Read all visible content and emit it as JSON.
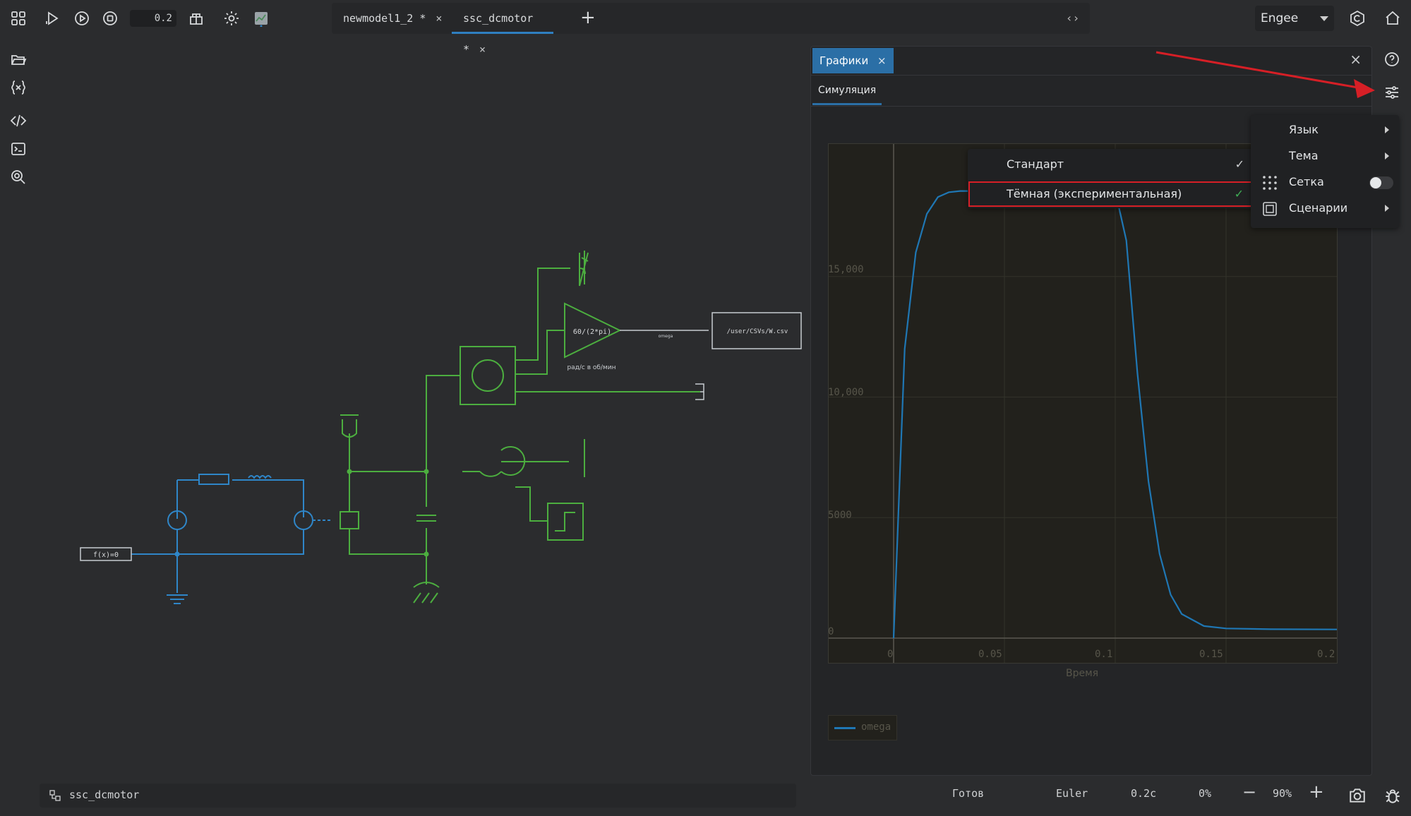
{
  "toolbar": {
    "sim_time": "0.2",
    "tabs": [
      {
        "label": "newmodel1_2 *",
        "close": "×"
      },
      {
        "label": "ssc_dcmotor *",
        "close": "×"
      }
    ],
    "add_tab": "+",
    "nav_arrows": "‹›",
    "user": "Engee"
  },
  "diagram": {
    "gain_label": "60/(2*pi)",
    "gain_note": "рад/с в об/мин",
    "signal_label": "omega",
    "sink_label": "/user/CSVs/W.csv",
    "func_label": "f(x)=0"
  },
  "plots_panel": {
    "tab_label": "Графики",
    "tab_close": "×",
    "panel_close": "×",
    "subtab": "Симуляция",
    "y_ticks": [
      "15,000",
      "10,000",
      "5000",
      "0"
    ],
    "x_ticks": [
      "0",
      "0.05",
      "0.1",
      "0.15",
      "0.2"
    ],
    "x_axis_label": "Время",
    "legend": "omega"
  },
  "theme_menu": {
    "items": [
      {
        "label": "Стандарт",
        "check": "✓"
      },
      {
        "label": "Тёмная (экспериментальная)",
        "check": "✓"
      }
    ]
  },
  "settings_menu": {
    "items": [
      {
        "label": "Язык"
      },
      {
        "label": "Тема"
      },
      {
        "label": "Сетка"
      },
      {
        "label": "Сценарии"
      }
    ]
  },
  "statusbar": {
    "model_name": "ssc_dcmotor",
    "state": "Готов",
    "solver": "Euler",
    "time": "0.2с",
    "progress": "0%",
    "zoom_minus": "−",
    "zoom": "90%",
    "zoom_plus": "+"
  },
  "chart_data": {
    "type": "line",
    "xlabel": "Время",
    "ylabel": "",
    "xlim": [
      0,
      0.2
    ],
    "ylim": [
      0,
      18500
    ],
    "series": [
      {
        "name": "omega",
        "color": "#1f77b4",
        "x": [
          0,
          0.005,
          0.01,
          0.015,
          0.02,
          0.025,
          0.03,
          0.06,
          0.1,
          0.105,
          0.11,
          0.115,
          0.12,
          0.125,
          0.13,
          0.14,
          0.15,
          0.17,
          0.2
        ],
        "y": [
          0,
          12000,
          16000,
          17600,
          18300,
          18500,
          18550,
          18550,
          18550,
          16500,
          11000,
          6500,
          3500,
          1800,
          1000,
          500,
          400,
          370,
          360
        ]
      }
    ]
  },
  "colors": {
    "accent": "#2b6fa6",
    "highlight": "#d61f26",
    "wire_green": "#4cae3f",
    "wire_blue": "#2f86c8"
  }
}
